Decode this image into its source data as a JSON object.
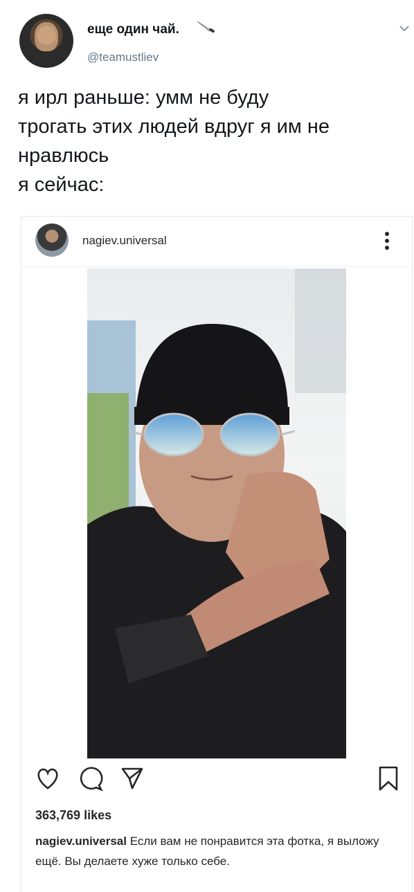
{
  "tweet": {
    "display_name": "еще один чай.",
    "handle": "@teamustliev",
    "text": "я ирл раньше: умм не буду\nтрогать этих людей вдруг я им не\nнравлюсь\nя сейчас:",
    "icons": {
      "emoji": "knife-icon",
      "menu": "chevron-down-icon"
    }
  },
  "instagram_post": {
    "username": "nagiev.universal",
    "likes": "363,769 likes",
    "caption_user": "nagiev.universal",
    "caption_text": "Если вам не понравится эта фотка, я выложу ещё. Вы делаете хуже только себе.",
    "icons": [
      "heart-icon",
      "comment-icon",
      "share-icon",
      "bookmark-icon",
      "more-icon"
    ]
  }
}
